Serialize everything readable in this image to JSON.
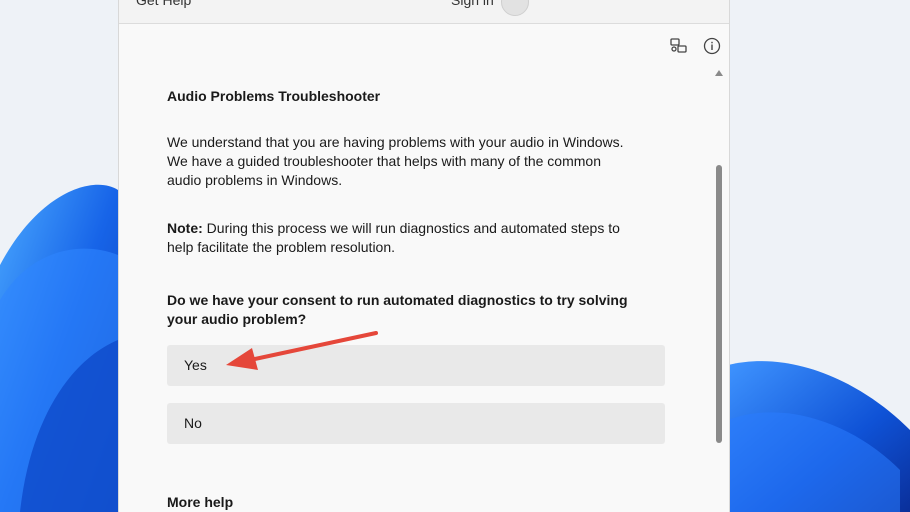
{
  "header": {
    "get_help": "Get Help",
    "sign_in": "Sign in"
  },
  "toolbar": {
    "icons": [
      "feedback-icon",
      "info-icon"
    ]
  },
  "main": {
    "title": "Audio Problems Troubleshooter",
    "intro": "We understand that you are having problems with your audio in Windows. We have a guided troubleshooter that helps with many of the common audio problems in Windows.",
    "note_label": "Note:",
    "note_text": " During this process we will run diagnostics and automated steps to help facilitate the problem resolution.",
    "question": "Do we have your consent to run automated diagnostics to try solving your audio problem?",
    "options": [
      {
        "label": "Yes"
      },
      {
        "label": "No"
      }
    ],
    "more_help": "More help"
  },
  "colors": {
    "accent": "#e5473a",
    "option_bg": "#e9e9e9",
    "window_bg": "#f9f9f9",
    "wallpaper": "#1565e0"
  }
}
